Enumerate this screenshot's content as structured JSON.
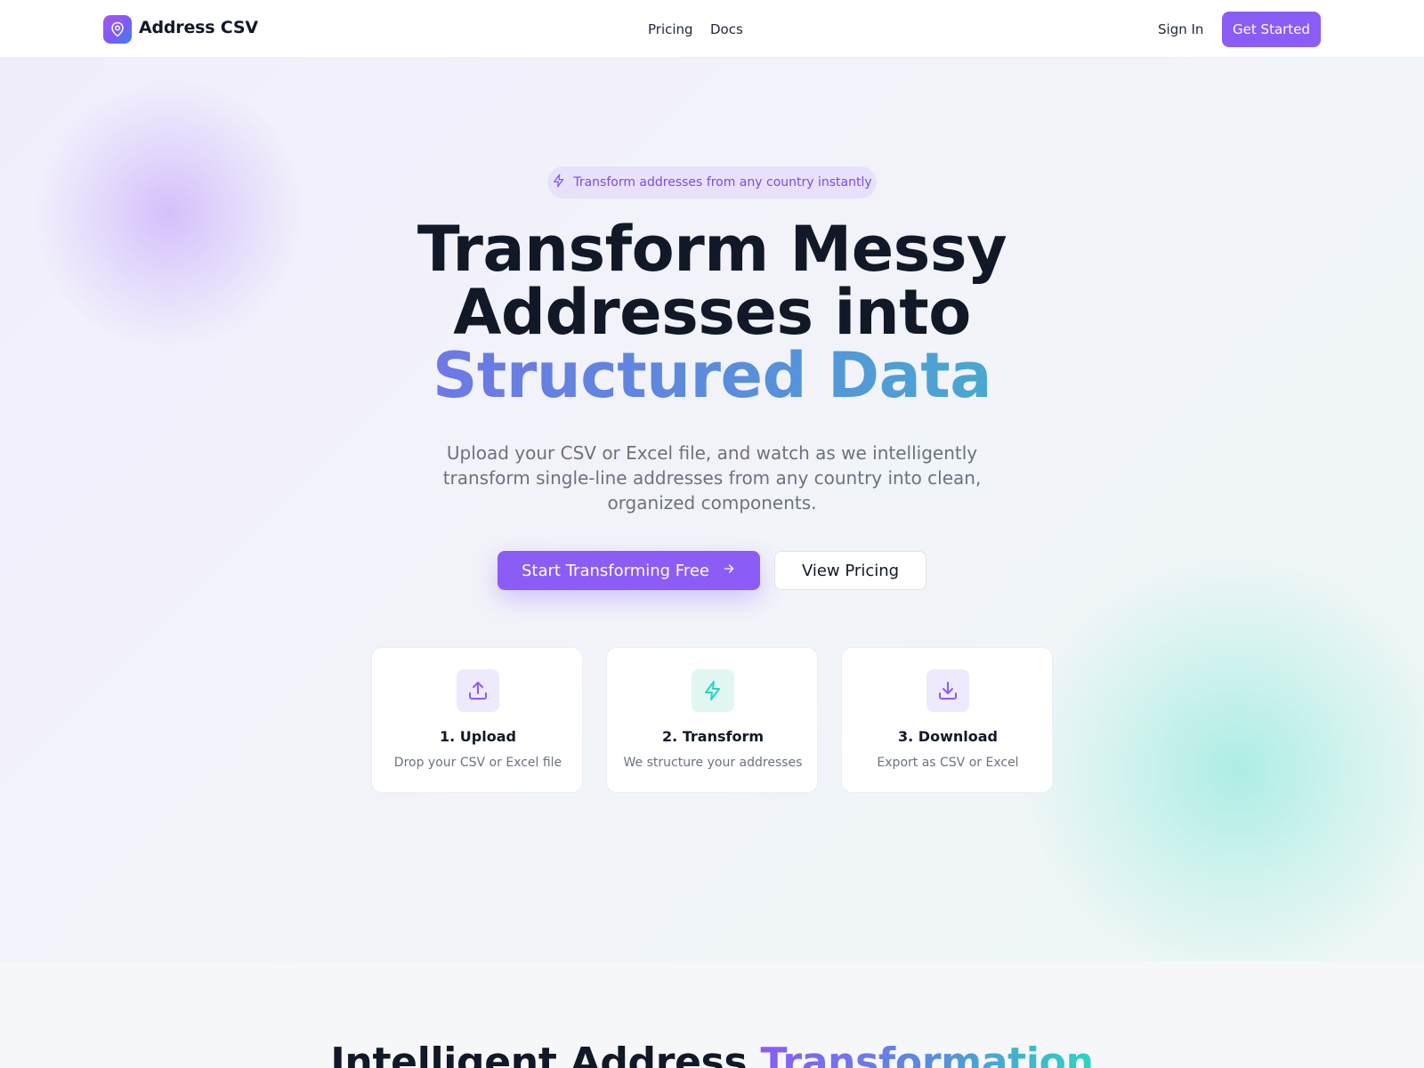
{
  "header": {
    "brand": "Address CSV",
    "nav": {
      "pricing": "Pricing",
      "docs": "Docs"
    },
    "sign_in": "Sign In",
    "get_started": "Get Started"
  },
  "hero": {
    "badge": "Transform addresses from any country instantly",
    "headline_line1": "Transform Messy",
    "headline_line2": "Addresses into",
    "headline_highlight": "Structured Data",
    "subtitle": "Upload your CSV or Excel file, and watch as we intelligently transform single-line addresses from any country into clean, organized components.",
    "primary_cta": "Start Transforming Free",
    "secondary_cta": "View Pricing"
  },
  "steps": [
    {
      "icon": "upload-icon",
      "title": "1. Upload",
      "description": "Drop your CSV or Excel file"
    },
    {
      "icon": "lightning-icon",
      "title": "2. Transform",
      "description": "We structure your addresses"
    },
    {
      "icon": "download-icon",
      "title": "3. Download",
      "description": "Export as CSV or Excel"
    }
  ],
  "features": {
    "heading_plain": "Intelligent Address ",
    "heading_highlight": "Transformation"
  },
  "colors": {
    "accent": "#8b5cf6",
    "teal": "#2dd4bf",
    "text": "#111827",
    "muted": "#6b7280"
  }
}
